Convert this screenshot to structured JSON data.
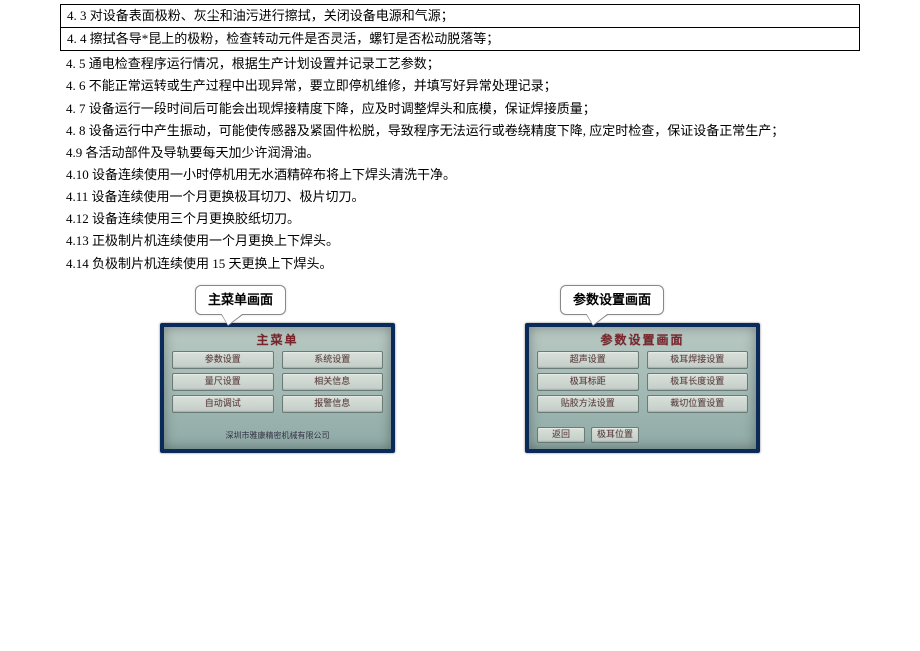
{
  "lines": {
    "l1": "4.  3 对设备表面极粉、灰尘和油污进行擦拭，关闭设备电源和气源；",
    "l2": "4.  4 擦拭各导*昆上的极粉，检查转动元件是否灵活，螺钉是否松动脱落等；",
    "l3": "4.  5 通电检查程序运行情况，根据生产计划设置并记录工艺参数；",
    "l4": "4.  6 不能正常运转或生产过程中出现异常，要立即停机维修，并填写好异常处理记录；",
    "l5": "4.  7 设备运行一段时间后可能会出现焊接精度下降，应及时调整焊头和底模，保证焊接质量；",
    "l6": "4.  8 设备运行中产生振动，可能使传感器及紧固件松脱，导致程序无法运行或卷绕精度下降, 应定时检查，保证设备正常生产；",
    "l7": "4.9 各活动部件及导轨要每天加少许润滑油。",
    "l8": "4.10 设备连续使用一小时停机用无水酒精碎布将上下焊头清洗干净。",
    "l9": "4.11 设备连续使用一个月更换极耳切刀、极片切刀。",
    "l10": "4.12 设备连续使用三个月更换胶纸切刀。",
    "l11": "4.13 正极制片机连续使用一个月更换上下焊头。",
    "l12": "4.14 负极制片机连续使用 15 天更换上下焊头。"
  },
  "screen1": {
    "callout": "主菜单画面",
    "title": "主菜单",
    "buttons": [
      "参数设置",
      "系统设置",
      "量尺设置",
      "相关信息",
      "自动调试",
      "报警信息"
    ],
    "footer": "深圳市雅康精密机械有限公司"
  },
  "screen2": {
    "callout": "参数设置画面",
    "title": "参数设置画面",
    "buttons": [
      "超声设置",
      "极耳焊接设置",
      "极耳标距",
      "极耳长度设置",
      "贴胶方法设置",
      "裁切位置设置",
      "返回",
      "极耳位置"
    ]
  }
}
